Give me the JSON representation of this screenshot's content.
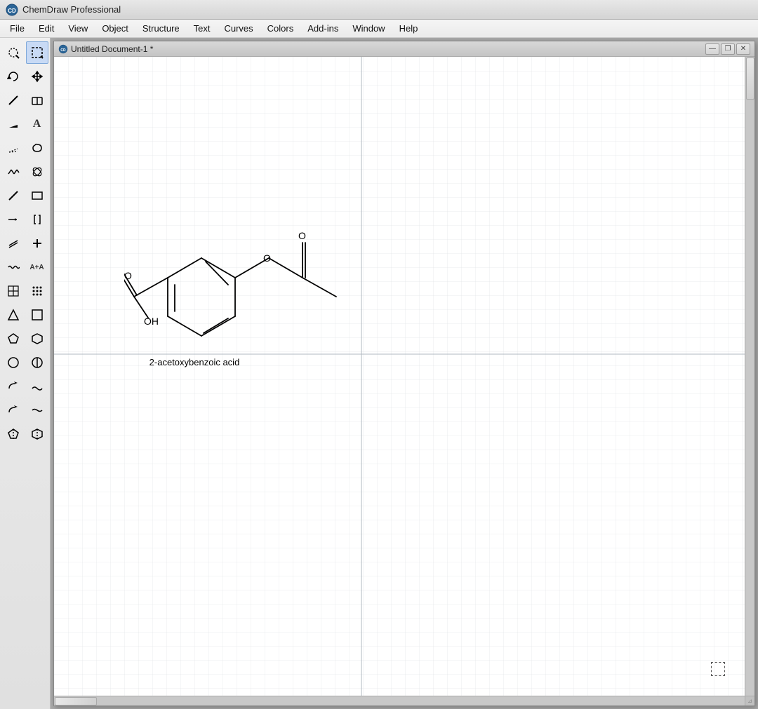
{
  "app": {
    "title": "ChemDraw Professional",
    "icon": "CD"
  },
  "menubar": {
    "items": [
      "File",
      "Edit",
      "View",
      "Object",
      "Structure",
      "Text",
      "Curves",
      "Colors",
      "Add-ins",
      "Window",
      "Help"
    ]
  },
  "document": {
    "title": "Untitled Document-1 *",
    "icon": "CD",
    "controls": {
      "minimize": "—",
      "maximize": "❐",
      "close": "✕"
    }
  },
  "molecule": {
    "name": "2-acetoxybenzoic acid"
  },
  "toolbar": {
    "tools": [
      {
        "id": "select-lasso",
        "label": "⊹",
        "title": "Select/Lasso"
      },
      {
        "id": "select-rect",
        "label": "⬚",
        "title": "Select Rectangle"
      },
      {
        "id": "rotate",
        "label": "↺",
        "title": "Rotate"
      },
      {
        "id": "move",
        "label": "↗",
        "title": "Move"
      },
      {
        "id": "bond-single",
        "label": "╱",
        "title": "Single Bond"
      },
      {
        "id": "eraser",
        "label": "◫",
        "title": "Eraser"
      },
      {
        "id": "bond-dash",
        "label": "╱",
        "title": "Dashed Bond"
      },
      {
        "id": "text",
        "label": "A",
        "title": "Text"
      },
      {
        "id": "bond-wedge",
        "label": "▷",
        "title": "Wedge Bond"
      },
      {
        "id": "lasso",
        "label": "∿",
        "title": "Lasso"
      },
      {
        "id": "chain",
        "label": "⋮",
        "title": "Chain"
      },
      {
        "id": "flower",
        "label": "✿",
        "title": "Orbital"
      },
      {
        "id": "line",
        "label": "╲",
        "title": "Line"
      },
      {
        "id": "rect",
        "label": "□",
        "title": "Rectangle"
      },
      {
        "id": "arrow",
        "label": "╱",
        "title": "Arrow"
      },
      {
        "id": "bracket",
        "label": "⌐",
        "title": "Bracket"
      },
      {
        "id": "bond-double",
        "label": "═",
        "title": "Double Bond"
      },
      {
        "id": "plus",
        "label": "+",
        "title": "Plus"
      },
      {
        "id": "wavy",
        "label": "∿",
        "title": "Wavy Bond"
      },
      {
        "id": "atom-map",
        "label": "A+A",
        "title": "Atom Map"
      },
      {
        "id": "table",
        "label": "⊞",
        "title": "Table"
      },
      {
        "id": "dotgrid",
        "label": "⁝⁝",
        "title": "Dot Grid"
      },
      {
        "id": "triangle",
        "label": "△",
        "title": "Triangle"
      },
      {
        "id": "square",
        "label": "□",
        "title": "Square"
      },
      {
        "id": "pentagon",
        "label": "⬠",
        "title": "Pentagon"
      },
      {
        "id": "hexagon",
        "label": "⬡",
        "title": "Hexagon"
      },
      {
        "id": "heptagon",
        "label": "○",
        "title": "Heptagon"
      },
      {
        "id": "octagon",
        "label": "○",
        "title": "Octagon"
      },
      {
        "id": "arrow2",
        "label": "⟵",
        "title": "Arrow 2"
      },
      {
        "id": "wave2",
        "label": "∽",
        "title": "Wave 2"
      },
      {
        "id": "arrow3",
        "label": "⟵",
        "title": "Arrow 3"
      },
      {
        "id": "wave3",
        "label": "∽",
        "title": "Wave 3"
      },
      {
        "id": "pentagon2",
        "label": "⬠",
        "title": "Pentagon 2"
      },
      {
        "id": "hexagon2",
        "label": "⬡",
        "title": "Hexagon 2"
      }
    ]
  },
  "colors": {
    "grid": "#d8dce0",
    "pageDivider": "#b0b8c0",
    "background": "#ffffff"
  }
}
